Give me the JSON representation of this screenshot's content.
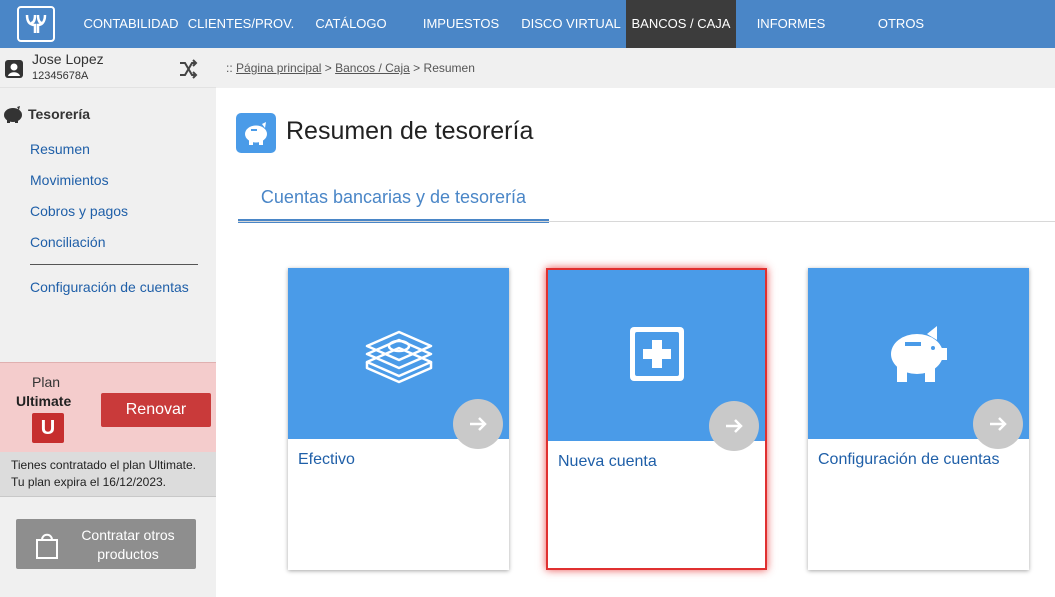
{
  "nav": {
    "items": [
      "CONTABILIDAD",
      "CLIENTES/PROV.",
      "CATÁLOGO",
      "IMPUESTOS",
      "DISCO VIRTUAL",
      "BANCOS / CAJA",
      "INFORMES",
      "OTROS"
    ],
    "active": "BANCOS / CAJA"
  },
  "user": {
    "name": "Jose Lopez",
    "id": "12345678A"
  },
  "sidebar": {
    "section_title": "Tesorería",
    "links": [
      "Resumen",
      "Movimientos",
      "Cobros y pagos",
      "Conciliación",
      "Configuración de cuentas"
    ]
  },
  "plan": {
    "label": "Plan",
    "name": "Ultimate",
    "badge": "U",
    "renew_label": "Renovar",
    "info_line1": "Tienes contratado el plan Ultimate.",
    "info_line2": "Tu plan expira el 16/12/2023.",
    "buy_label_line1": "Contratar otros",
    "buy_label_line2": "productos"
  },
  "breadcrumb": {
    "prefix": "::",
    "home": "Página principal",
    "section": "Bancos / Caja",
    "current": "Resumen",
    "sep": ">"
  },
  "page": {
    "title": "Resumen de tesorería",
    "tab": "Cuentas bancarias y de tesorería"
  },
  "cards": [
    {
      "label": "Efectivo",
      "icon": "cash-stack-icon"
    },
    {
      "label": "Nueva cuenta",
      "icon": "plus-square-icon"
    },
    {
      "label": "Configuración de cuentas",
      "icon": "piggy-bank-icon"
    }
  ],
  "colors": {
    "nav_bg": "#4a86c7",
    "nav_active": "#3c3c3c",
    "card_top": "#4a9be8",
    "link": "#1f5fa8",
    "renew": "#c93a3a",
    "plan_bg": "#f4cccc"
  }
}
